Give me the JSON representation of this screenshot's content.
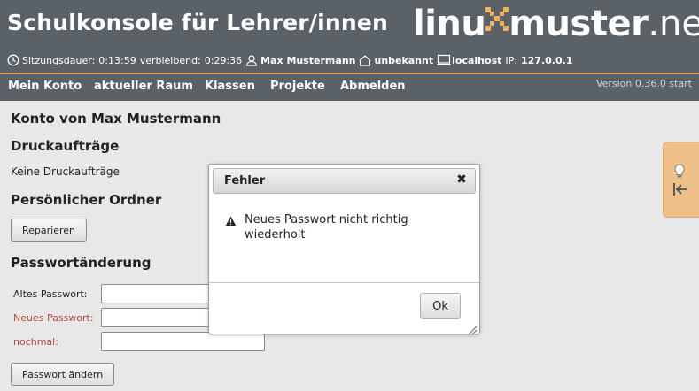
{
  "header": {
    "app_title": "Schulkonsole für Lehrer/innen",
    "logo": {
      "part1": "linu",
      "part2": "muster",
      "part3": ".net"
    }
  },
  "session": {
    "duration_label": "Sitzungsdauer:",
    "duration_value": "0:13:59",
    "remaining_label": "verbleibend:",
    "remaining_value": "0:29:36",
    "user": "Max Mustermann",
    "room": "unbekannt",
    "host": "localhost",
    "ip_label": "IP:",
    "ip_value": "127.0.0.1"
  },
  "nav": {
    "items": [
      {
        "label": "Mein Konto"
      },
      {
        "label": "aktueller Raum"
      },
      {
        "label": "Klassen"
      },
      {
        "label": "Projekte"
      },
      {
        "label": "Abmelden"
      }
    ],
    "version": "Version 0.36.0 start"
  },
  "main": {
    "account_title": "Konto von Max Mustermann",
    "print_jobs_title": "Druckaufträge",
    "print_jobs_empty": "Keine Druckaufträge",
    "personal_folder_title": "Persönlicher Ordner",
    "repair_button": "Reparieren",
    "password_change_title": "Passwortänderung",
    "old_password_label": "Altes Passwort:",
    "new_password_label": "Neues Passwort:",
    "repeat_label": "nochmal:",
    "change_password_button": "Passwort ändern"
  },
  "dialog": {
    "title": "Fehler",
    "close_symbol": "✖",
    "message": "Neues Passwort nicht richtig wiederholt",
    "ok_button": "Ok"
  },
  "colors": {
    "header_bg": "#5a6268",
    "accent": "#f0b45c",
    "error_label": "#b04a3e"
  }
}
